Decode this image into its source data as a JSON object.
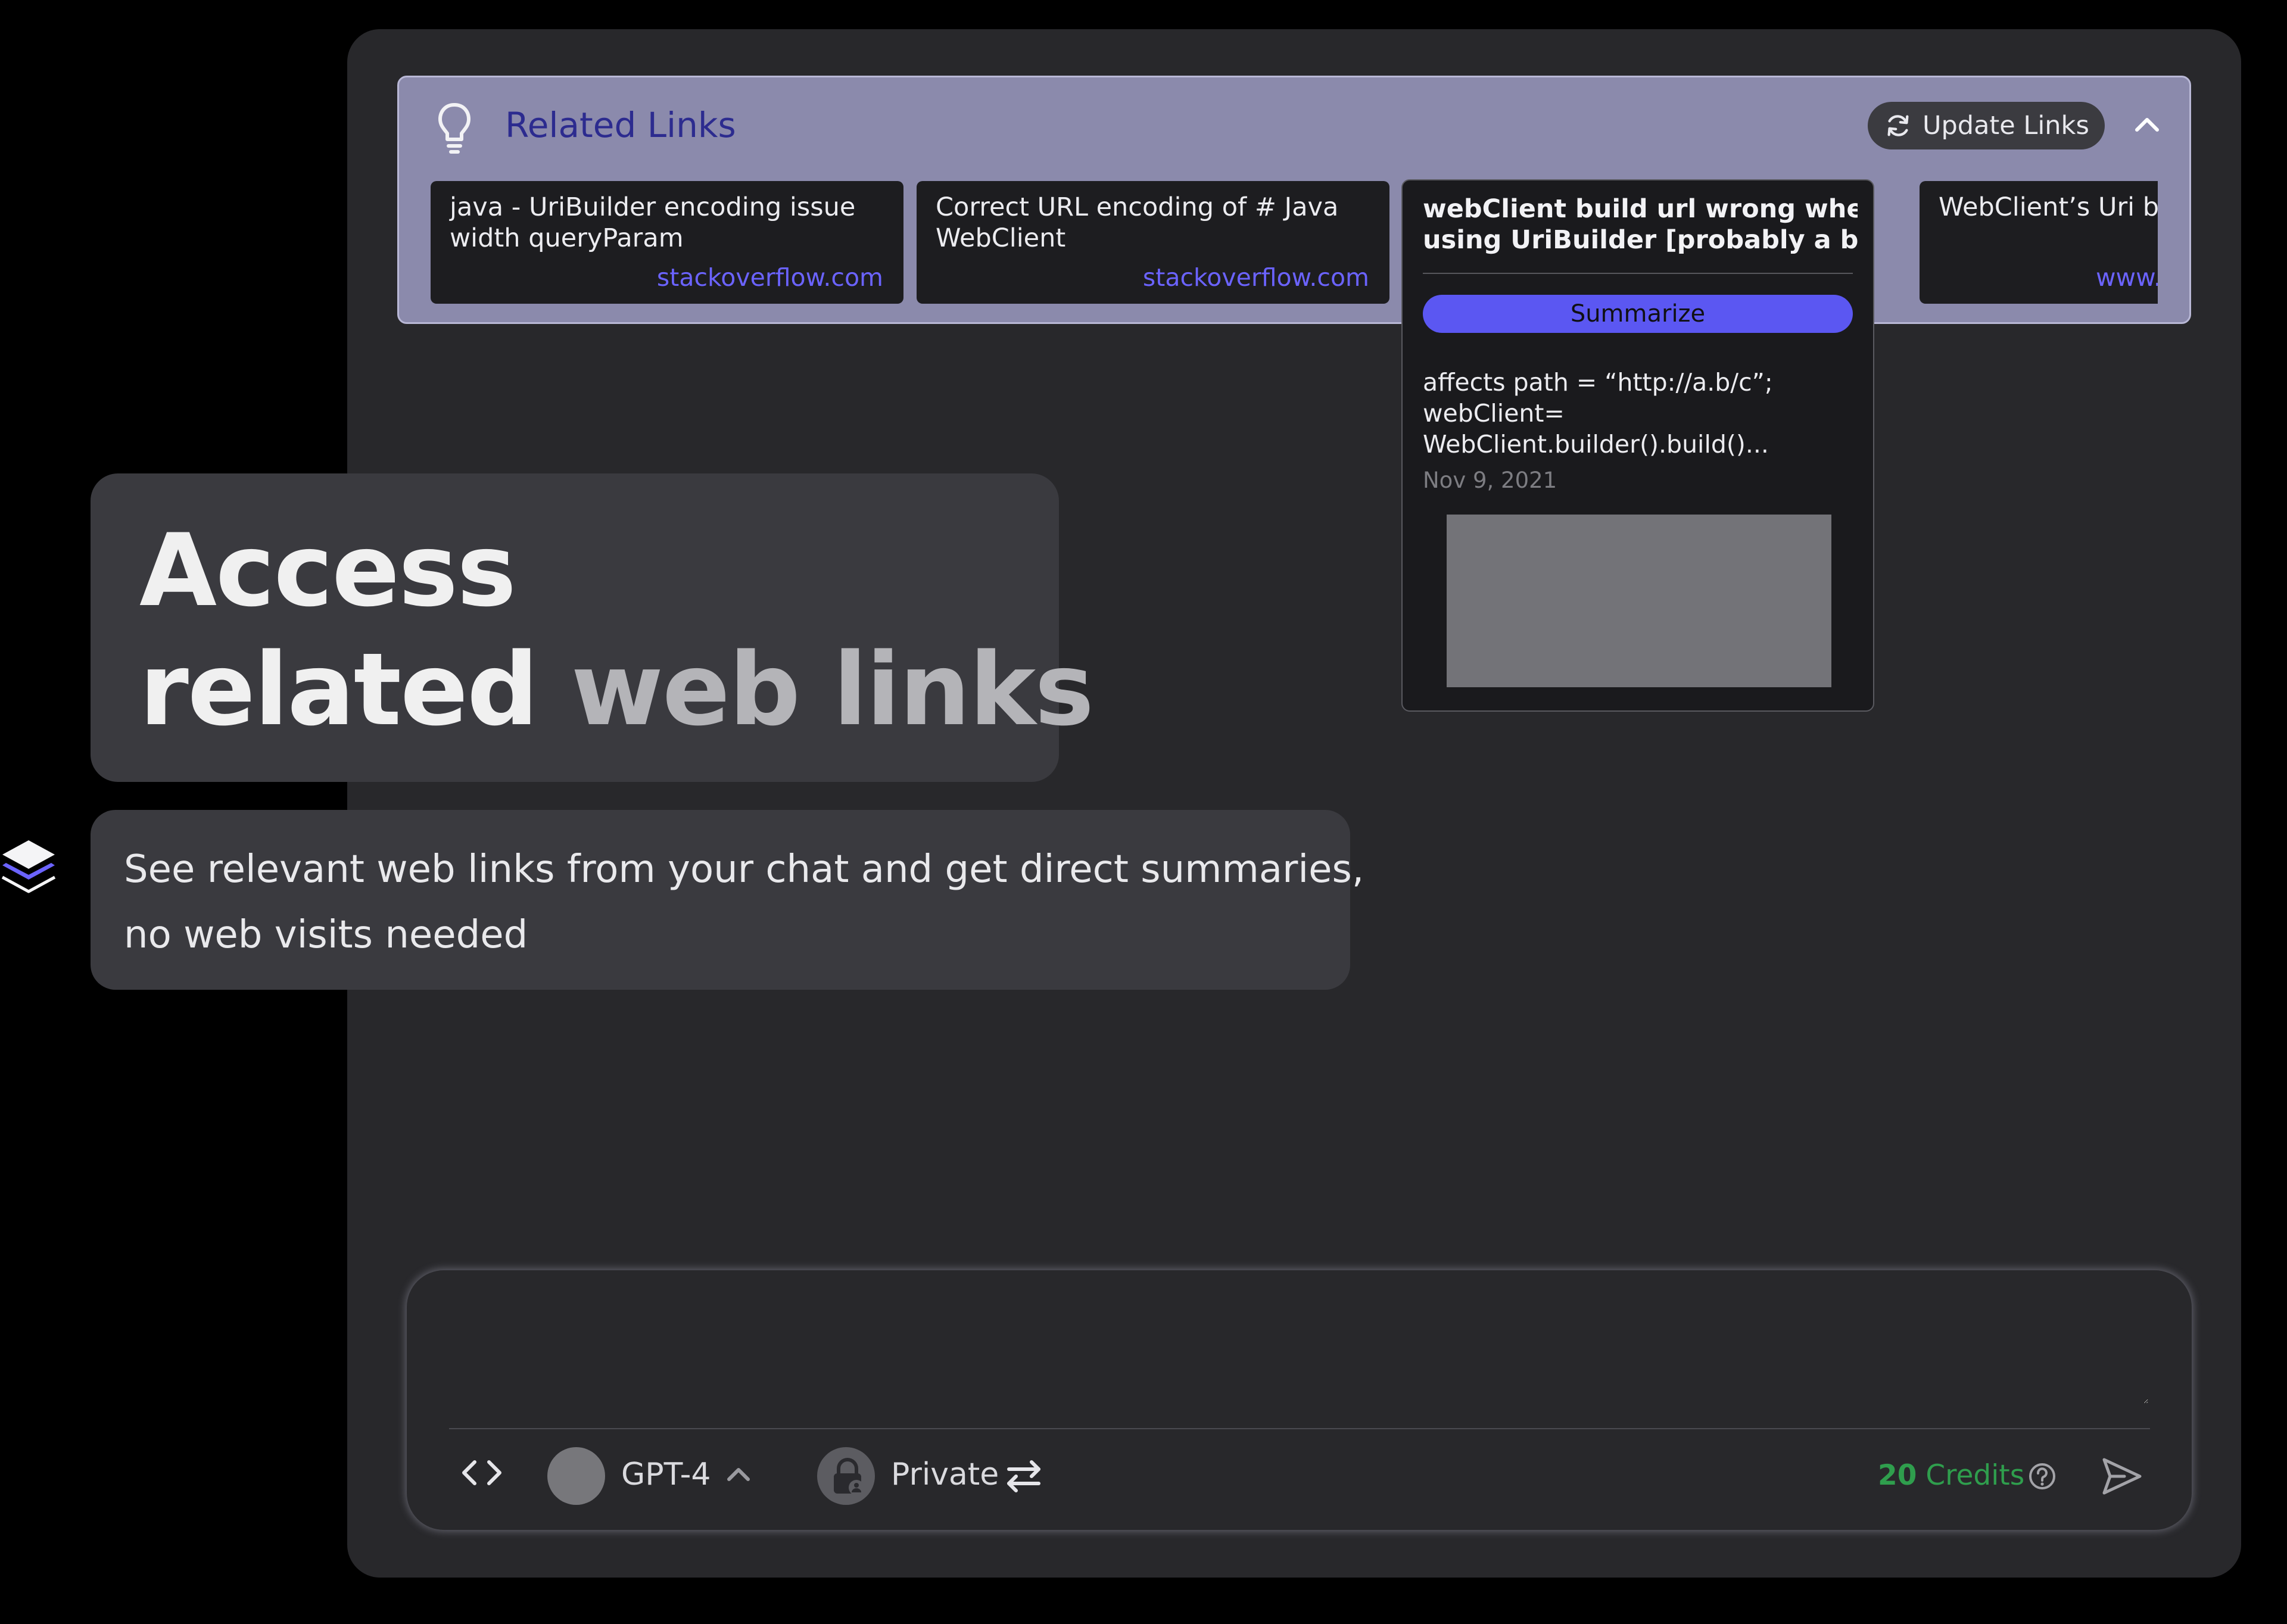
{
  "related_links": {
    "title": "Related Links",
    "update_label": "Update Links",
    "cards": [
      {
        "title_lines": [
          "java - UriBuilder encoding issue",
          "width queryParam"
        ],
        "source": "stackoverflow.com"
      },
      {
        "title_lines": [
          "Correct URL encoding of # Java",
          "WebClient"
        ],
        "source": "stackoverflow.com"
      },
      {
        "title_lines": [
          "WebClient’s Uri buil"
        ],
        "source": "www.fre"
      }
    ],
    "expanded_card": {
      "title_lines": [
        "webClient build url wrong when",
        "using UriBuilder [probably a bug.."
      ],
      "summarize_label": "Summarize",
      "excerpt_lines": [
        "affects path = “http://a.b/c”;",
        "webClient=",
        "WebClient.builder().build()..."
      ],
      "date": "Nov 9, 2021"
    }
  },
  "headline": {
    "line1": "Access",
    "line2_part1": "related",
    "line2_part2": "web links"
  },
  "description": {
    "lines": [
      "See relevant web links from your chat and get direct summaries,",
      "no web visits needed"
    ]
  },
  "composer": {
    "input_value": "",
    "model_label": "GPT-4",
    "privacy_label": "Private",
    "credits_count": "20",
    "credits_label": "Credits"
  },
  "icons": {
    "bulb": "lightbulb-icon",
    "refresh": "refresh-icon",
    "collapse": "chevron-up-icon",
    "layers": "layers-icon",
    "code": "code-icon",
    "model_chevron": "chevron-up-icon",
    "lock": "lock-icon",
    "swap": "swap-icon",
    "help": "help-icon",
    "send": "send-icon"
  },
  "colors": {
    "accent": "#5b57f2",
    "link": "#6b63ff",
    "credits": "#2f9e4d",
    "related_bar": "#8b8aac",
    "related_title": "#2c2b8f"
  }
}
